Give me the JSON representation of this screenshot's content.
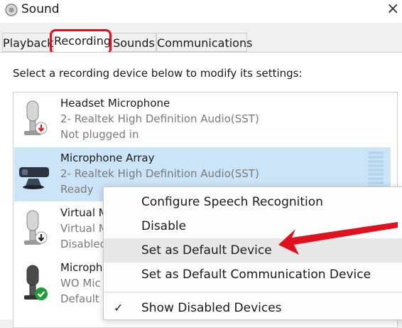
{
  "window": {
    "title": "Sound",
    "icon": "speaker-icon",
    "close": "×"
  },
  "tabs": [
    {
      "label": "Playback",
      "active": false
    },
    {
      "label": "Recording",
      "active": true
    },
    {
      "label": "Sounds",
      "active": false
    },
    {
      "label": "Communications",
      "active": false
    }
  ],
  "instruction": "Select a recording device below to modify its settings:",
  "devices": [
    {
      "name": "Headset Microphone",
      "driver": "2- Realtek High Definition Audio(SST)",
      "status": "Not plugged in",
      "icon": "microphone-unplugged-icon"
    },
    {
      "name": "Microphone Array",
      "driver": "2- Realtek High Definition Audio(SST)",
      "status": "Ready",
      "icon": "microphone-array-icon",
      "selected": true
    },
    {
      "name": "Virtual M",
      "driver": "Virtual M",
      "status": "Disabled",
      "icon": "microphone-disabled-icon"
    },
    {
      "name": "Microph",
      "driver": "WO Mic",
      "status": "Default D",
      "icon": "microphone-default-icon"
    }
  ],
  "context_menu": {
    "items": [
      {
        "label": "Configure Speech Recognition"
      },
      {
        "label": "Disable"
      },
      {
        "label": "Set as Default Device",
        "highlighted": true
      },
      {
        "label": "Set as Default Communication Device"
      },
      {
        "label": "Show Disabled Devices",
        "checked": true,
        "check_glyph": "✓"
      }
    ]
  },
  "colors": {
    "highlight": "#e0101e",
    "selected_row": "#cce4f7",
    "default_badge": "#1f9d3a"
  }
}
